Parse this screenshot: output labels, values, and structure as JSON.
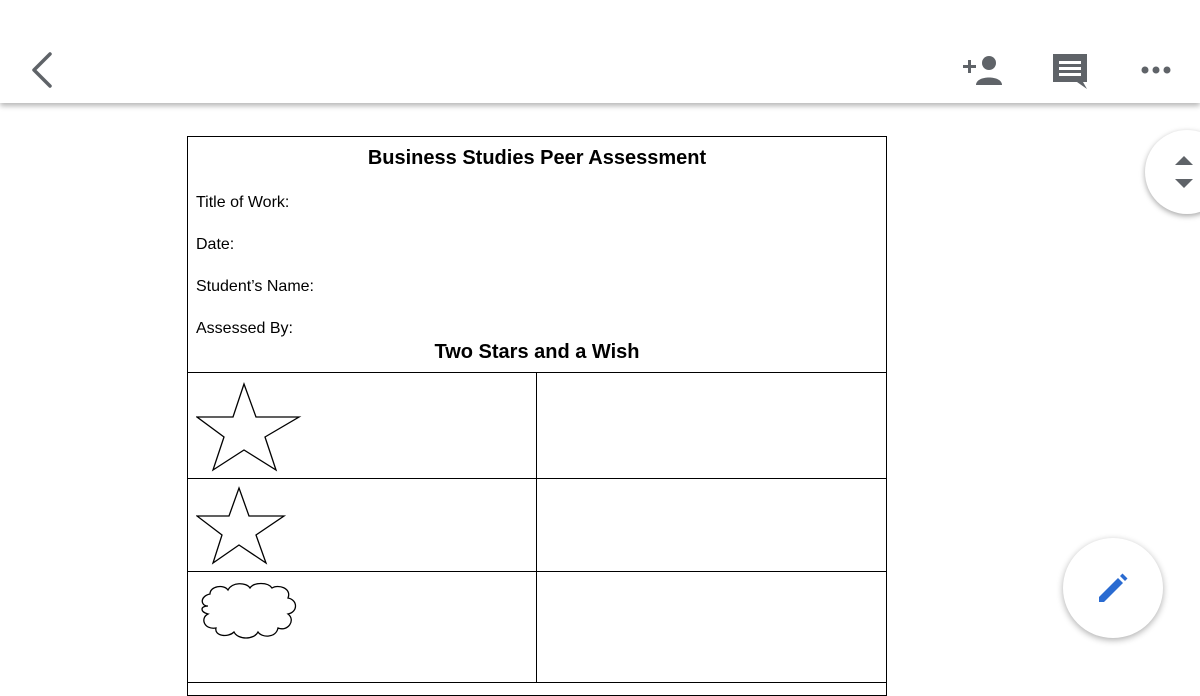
{
  "toolbar": {
    "icons": [
      "back-arrow-icon",
      "add-person-icon",
      "comment-icon",
      "more-options-icon"
    ],
    "icon_color": "#5f6368"
  },
  "document": {
    "title": "Business Studies Peer Assessment",
    "fields": [
      "Title of Work:",
      "Date:",
      "Student’s Name:",
      "Assessed By:"
    ],
    "section_title": "Two Stars and a Wish",
    "rows": [
      {
        "icon": "star-icon"
      },
      {
        "icon": "star-icon"
      },
      {
        "icon": "cloud-icon"
      }
    ]
  },
  "fab": {
    "icon": "edit-pencil-icon",
    "color": "#2a6bd1"
  },
  "scroll_handle": {
    "icon": "scroll-up-down-icon"
  }
}
